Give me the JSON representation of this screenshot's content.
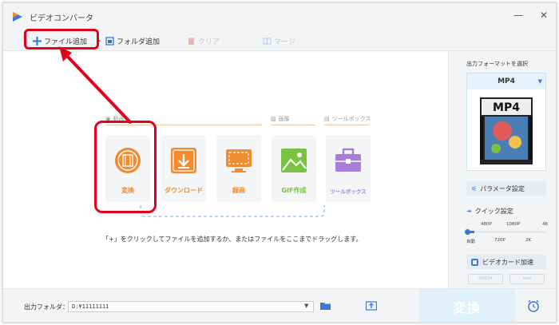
{
  "window": {
    "title": "ビデオコンバータ"
  },
  "toolbar": {
    "add_file": "ファイル追加",
    "add_folder": "フォルダ追加",
    "clear": "クリア",
    "merge": "マージ"
  },
  "categories": {
    "video": "動画",
    "image": "画像",
    "toolbox": "ツールボックス"
  },
  "cards": {
    "convert": "変換",
    "download": "ダウンロード",
    "record": "録画",
    "gif": "GIF作成",
    "toolbox": "ツールボックス"
  },
  "hint": "「+」をクリックしてファイルを追加するか、またはファイルをここまでドラッグします。",
  "right_panel": {
    "output_format_title": "出力フォーマットを選択",
    "selected_format": "MP4",
    "format_icon_text": "MP4",
    "parameter_settings": "パラメータ設定",
    "quick_settings": "クイック設定",
    "quality_ticks_top": [
      "480P",
      "1080P",
      "4K"
    ],
    "quality_ticks_bottom": [
      "自動",
      "720P",
      "2K"
    ],
    "gpu_accel": "ビデオカード加速",
    "gpu_brands": [
      "NVIDIA",
      "Intel"
    ]
  },
  "bottom": {
    "output_folder_label": "出力フォルダ：",
    "output_folder_value": "D:¥11111111",
    "convert_label": "変換"
  },
  "colors": {
    "accent_orange": "#f28b2e",
    "gif_green": "#7bc142",
    "toolbox_purple": "#a77dd8",
    "highlight_red": "#e3001b",
    "convert_btn": "#dff0fa"
  }
}
